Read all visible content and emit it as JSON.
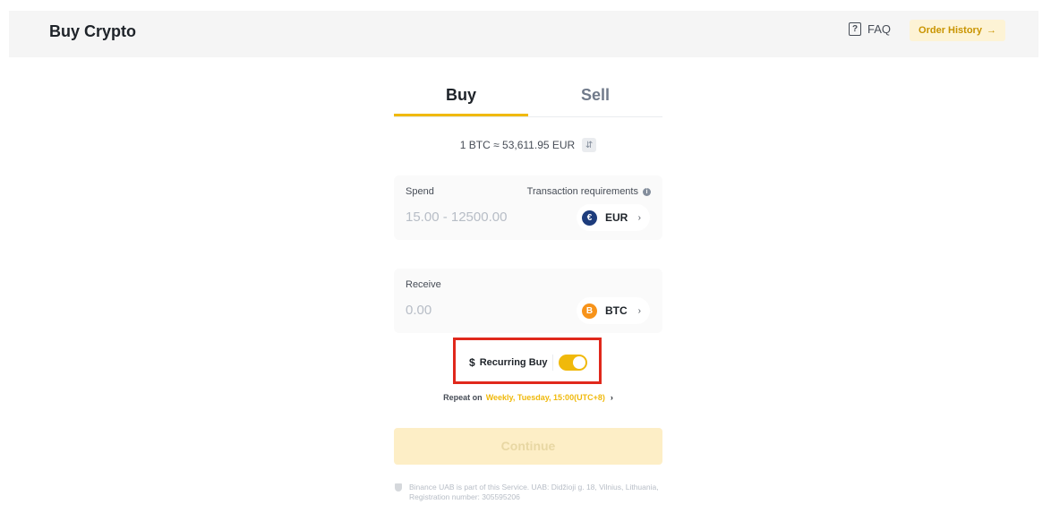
{
  "header": {
    "title": "Buy Crypto",
    "faq_label": "FAQ",
    "order_history_label": "Order History",
    "order_history_arrow": "→"
  },
  "tabs": [
    {
      "label": "Buy",
      "active": true
    },
    {
      "label": "Sell",
      "active": false
    }
  ],
  "rate": {
    "text": "1 BTC ≈ 53,611.95 EUR",
    "swap_glyph": "⇵"
  },
  "spend": {
    "label": "Spend",
    "requirements_label": "Transaction requirements",
    "info_glyph": "i",
    "placeholder": "15.00 - 12500.00",
    "currency": "EUR",
    "currency_symbol": "€"
  },
  "receive": {
    "label": "Receive",
    "placeholder": "0.00",
    "currency": "BTC",
    "currency_symbol": "B"
  },
  "recurring": {
    "icon_glyph": "$",
    "label": "Recurring Buy",
    "enabled": true
  },
  "repeat": {
    "prefix": "Repeat on",
    "value": "Weekly, Tuesday, 15:00(UTC+8)"
  },
  "continue_label": "Continue",
  "disclaimer": "Binance UAB is part of this Service. UAB: Didžioji g. 18, Vilnius, Lithuania, Registration number: 305595206",
  "colors": {
    "accent": "#f0b90b",
    "highlight_border": "#e0281c",
    "eur_coin": "#1d3c7c",
    "btc_coin": "#f7931a"
  },
  "icons": [
    "faq-icon",
    "arrow-right-icon",
    "swap-icon",
    "info-icon",
    "eur-coin-icon",
    "btc-coin-icon",
    "chevron-right-icon",
    "recurring-buy-icon",
    "shield-icon"
  ]
}
